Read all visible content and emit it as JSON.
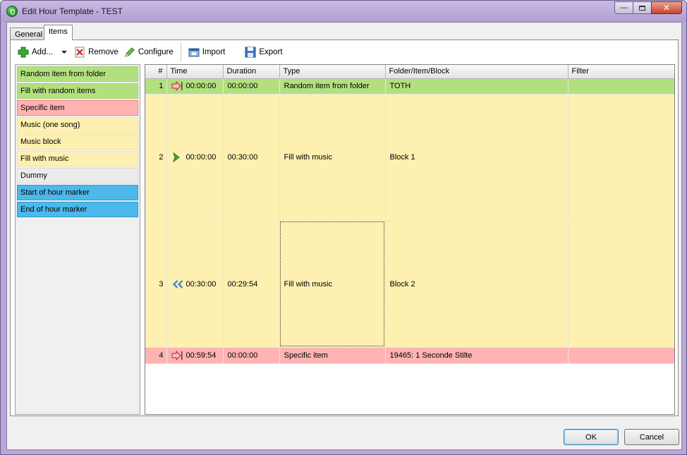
{
  "window": {
    "title": "Edit Hour Template - TEST"
  },
  "tabs": [
    {
      "label": "General"
    },
    {
      "label": "Items"
    }
  ],
  "toolbar": {
    "add": "Add...",
    "remove": "Remove",
    "configure": "Configure",
    "import": "Import",
    "export": "Export"
  },
  "palette": [
    {
      "label": "Random item from folder",
      "color": "#b3e07f",
      "border": "#a4d46e"
    },
    {
      "label": "Fill with random items",
      "color": "#b3e07f",
      "border": "#a4d46e"
    },
    {
      "label": "Specific item",
      "color": "#ffb3b3",
      "border": "#f08080"
    },
    {
      "label": "Music (one song)",
      "color": "#fdf0b0",
      "border": "#f5e59a"
    },
    {
      "label": "Music block",
      "color": "#fdf0b0",
      "border": "#f5e59a"
    },
    {
      "label": "Fill with music",
      "color": "#fdf0b0",
      "border": "#f5e59a"
    },
    {
      "label": "Dummy",
      "color": "#ececec",
      "border": "#dcdcdc"
    },
    {
      "label": "Start of hour marker",
      "color": "#4db8ea",
      "border": "#2e9fd6"
    },
    {
      "label": "End of hour marker",
      "color": "#4db8ea",
      "border": "#2e9fd6"
    }
  ],
  "grid": {
    "headers": {
      "num": "#",
      "time": "Time",
      "duration": "Duration",
      "type": "Type",
      "folder": "Folder/Item/Block",
      "filter": "Filter"
    },
    "rows": [
      {
        "num": "1",
        "icon": "arrow-right-red-icon",
        "time": "00:00:00",
        "duration": "00:00:00",
        "type": "Random item from folder",
        "folder": "TOTH",
        "filter": "",
        "color": "#b3e07f",
        "height": 22
      },
      {
        "num": "2",
        "icon": "chevron-right-green-icon",
        "time": "00:00:00",
        "duration": "00:30:00",
        "type": "Fill with music",
        "folder": "Block 1",
        "filter": "",
        "color": "#fdf0b0",
        "height": 180
      },
      {
        "num": "3",
        "icon": "double-chevron-left-blue-icon",
        "time": "00:30:00",
        "duration": "00:29:54",
        "type": "Fill with music",
        "folder": "Block 2",
        "filter": "",
        "color": "#fdf0b0",
        "height": 179
      },
      {
        "num": "4",
        "icon": "arrow-right-red-icon",
        "time": "00:59:54",
        "duration": "00:00:00",
        "type": "Specific item",
        "folder": "19465: 1 Seconde Stilte",
        "filter": "",
        "color": "#ffb3b3",
        "height": 23
      }
    ]
  },
  "buttons": {
    "ok": "OK",
    "cancel": "Cancel"
  }
}
